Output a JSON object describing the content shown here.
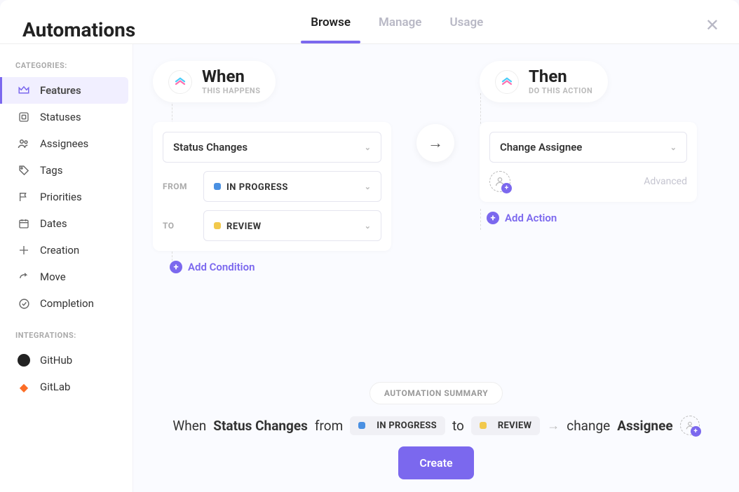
{
  "header": {
    "title": "Automations",
    "tabs": [
      "Browse",
      "Manage",
      "Usage"
    ],
    "active_tab": "Browse"
  },
  "sidebar": {
    "categories_label": "CATEGORIES:",
    "integrations_label": "INTEGRATIONS:",
    "categories": [
      {
        "label": "Features",
        "active": true
      },
      {
        "label": "Statuses"
      },
      {
        "label": "Assignees"
      },
      {
        "label": "Tags"
      },
      {
        "label": "Priorities"
      },
      {
        "label": "Dates"
      },
      {
        "label": "Creation"
      },
      {
        "label": "Move"
      },
      {
        "label": "Completion"
      }
    ],
    "integrations": [
      {
        "label": "GitHub"
      },
      {
        "label": "GitLab"
      }
    ]
  },
  "when": {
    "title": "When",
    "subtitle": "THIS HAPPENS",
    "trigger_select": "Status Changes",
    "from_label": "FROM",
    "from_status": "IN PROGRESS",
    "to_label": "TO",
    "to_status": "REVIEW",
    "add_condition": "Add Condition"
  },
  "then": {
    "title": "Then",
    "subtitle": "DO THIS ACTION",
    "action_select": "Change Assignee",
    "advanced": "Advanced",
    "add_action": "Add Action"
  },
  "summary": {
    "badge": "AUTOMATION SUMMARY",
    "when_word": "When",
    "trigger": "Status Changes",
    "from_word": "from",
    "from_status": "IN PROGRESS",
    "to_word": "to",
    "to_status": "REVIEW",
    "change_word": "change",
    "target": "Assignee",
    "create_btn": "Create"
  },
  "colors": {
    "primary": "#7b68ee",
    "status_in_progress": "#4a90e2",
    "status_review": "#f2c94c"
  }
}
